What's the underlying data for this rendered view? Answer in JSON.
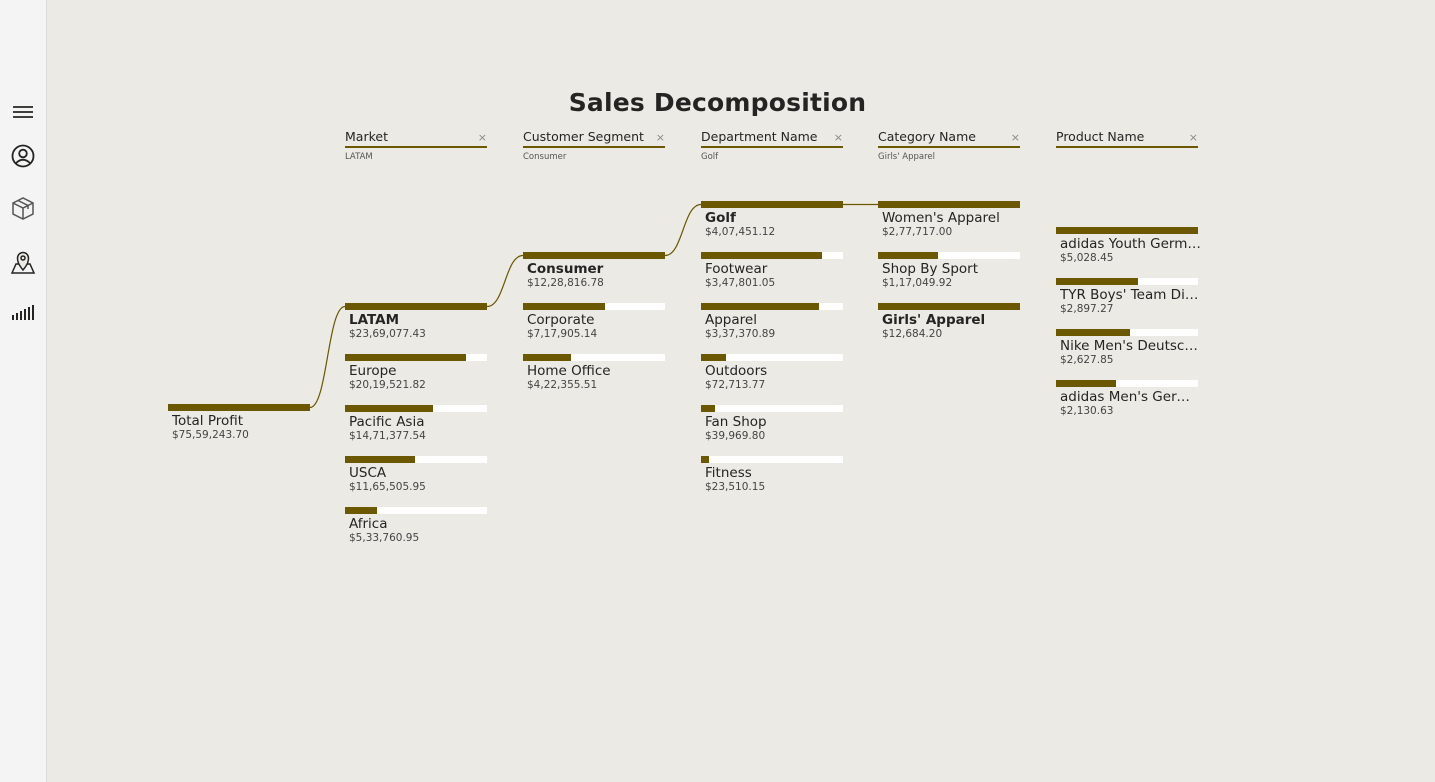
{
  "report": {
    "title": "Sales Decomposition"
  },
  "sidebar": {
    "items": [
      {
        "icon": "hamburger-menu-icon"
      },
      {
        "icon": "user-circle-icon"
      },
      {
        "icon": "package-box-icon"
      },
      {
        "icon": "map-pin-icon"
      },
      {
        "icon": "signal-bars-icon"
      }
    ]
  },
  "colors": {
    "accent": "#6b5800",
    "background": "#ebeae4",
    "track": "#ffffff"
  },
  "tree": {
    "root": {
      "label": "Total Profit",
      "value": "$75,59,243.70",
      "fraction": 1.0
    },
    "columns": [
      {
        "header": "Market",
        "selection": "LATAM",
        "has_close": true,
        "nodes": [
          {
            "label": "LATAM",
            "value": "$23,69,077.43",
            "fraction": 1.0,
            "selected": true
          },
          {
            "label": "Europe",
            "value": "$20,19,521.82",
            "fraction": 0.85
          },
          {
            "label": "Pacific Asia",
            "value": "$14,71,377.54",
            "fraction": 0.62
          },
          {
            "label": "USCA",
            "value": "$11,65,505.95",
            "fraction": 0.49
          },
          {
            "label": "Africa",
            "value": "$5,33,760.95",
            "fraction": 0.225
          }
        ]
      },
      {
        "header": "Customer Segment",
        "selection": "Consumer",
        "has_close": true,
        "nodes": [
          {
            "label": "Consumer",
            "value": "$12,28,816.78",
            "fraction": 1.0,
            "selected": true
          },
          {
            "label": "Corporate",
            "value": "$7,17,905.14",
            "fraction": 0.58
          },
          {
            "label": "Home Office",
            "value": "$4,22,355.51",
            "fraction": 0.34
          }
        ]
      },
      {
        "header": "Department Name",
        "selection": "Golf",
        "has_close": true,
        "nodes": [
          {
            "label": "Golf",
            "value": "$4,07,451.12",
            "fraction": 1.0,
            "selected": true
          },
          {
            "label": "Footwear",
            "value": "$3,47,801.05",
            "fraction": 0.85
          },
          {
            "label": "Apparel",
            "value": "$3,37,370.89",
            "fraction": 0.83
          },
          {
            "label": "Outdoors",
            "value": "$72,713.77",
            "fraction": 0.178
          },
          {
            "label": "Fan Shop",
            "value": "$39,969.80",
            "fraction": 0.098
          },
          {
            "label": "Fitness",
            "value": "$23,510.15",
            "fraction": 0.058
          }
        ]
      },
      {
        "header": "Category Name",
        "selection": "Girls' Apparel",
        "has_close": true,
        "nodes": [
          {
            "label": "Women's Apparel",
            "value": "$2,77,717.00",
            "fraction": 1.0
          },
          {
            "label": "Shop By Sport",
            "value": "$1,17,049.92",
            "fraction": 0.42
          },
          {
            "label": "Girls' Apparel",
            "value": "$12,684.20",
            "fraction": 0.046,
            "selected": true
          }
        ]
      },
      {
        "header": "Product Name",
        "selection": "",
        "has_close": true,
        "nodes": [
          {
            "label": "adidas Youth Germany Black/Red Away Match Soc",
            "value": "$5,028.45",
            "fraction": 1.0
          },
          {
            "label": "TYR Boys' Team Digi Jammer",
            "value": "$2,897.27",
            "fraction": 0.576
          },
          {
            "label": "Nike Men's Deutschland Weltmeister Winners Bl",
            "value": "$2,627.85",
            "fraction": 0.523
          },
          {
            "label": "adidas Men's Germany Black Crest Away Tee",
            "value": "$2,130.63",
            "fraction": 0.424
          }
        ]
      }
    ]
  }
}
